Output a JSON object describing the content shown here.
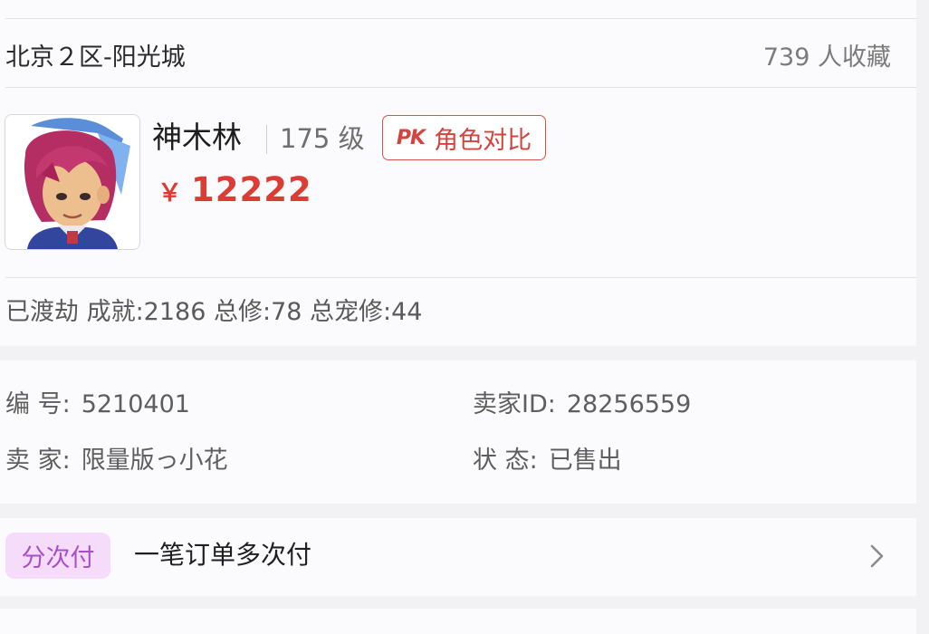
{
  "listing": {
    "server": "北京２区-阳光城",
    "favorites": "739 人收藏"
  },
  "character": {
    "name": "神木林",
    "level": "175 级",
    "compare_icon": "PK",
    "compare_label": "角色对比",
    "price_currency": "￥",
    "price": "12222",
    "stats": "已渡劫 成就:2186 总修:78 总宠修:44"
  },
  "details": {
    "id_label": "编 号:",
    "id_value": "5210401",
    "seller_id_label": "卖家ID:",
    "seller_id_value": "28256559",
    "seller_label": "卖 家:",
    "seller_value": "限量版っ小花",
    "status_label": "状 态:",
    "status_value": "已售出"
  },
  "installment": {
    "tag": "分次付",
    "text": "一笔订单多次付",
    "arrow_icon": "chevron-right-icon"
  },
  "colors": {
    "price": "#dd3c35",
    "pk_border": "#d9514c",
    "tag_bg": "#f5dcfa",
    "tag_text": "#a850c8"
  }
}
